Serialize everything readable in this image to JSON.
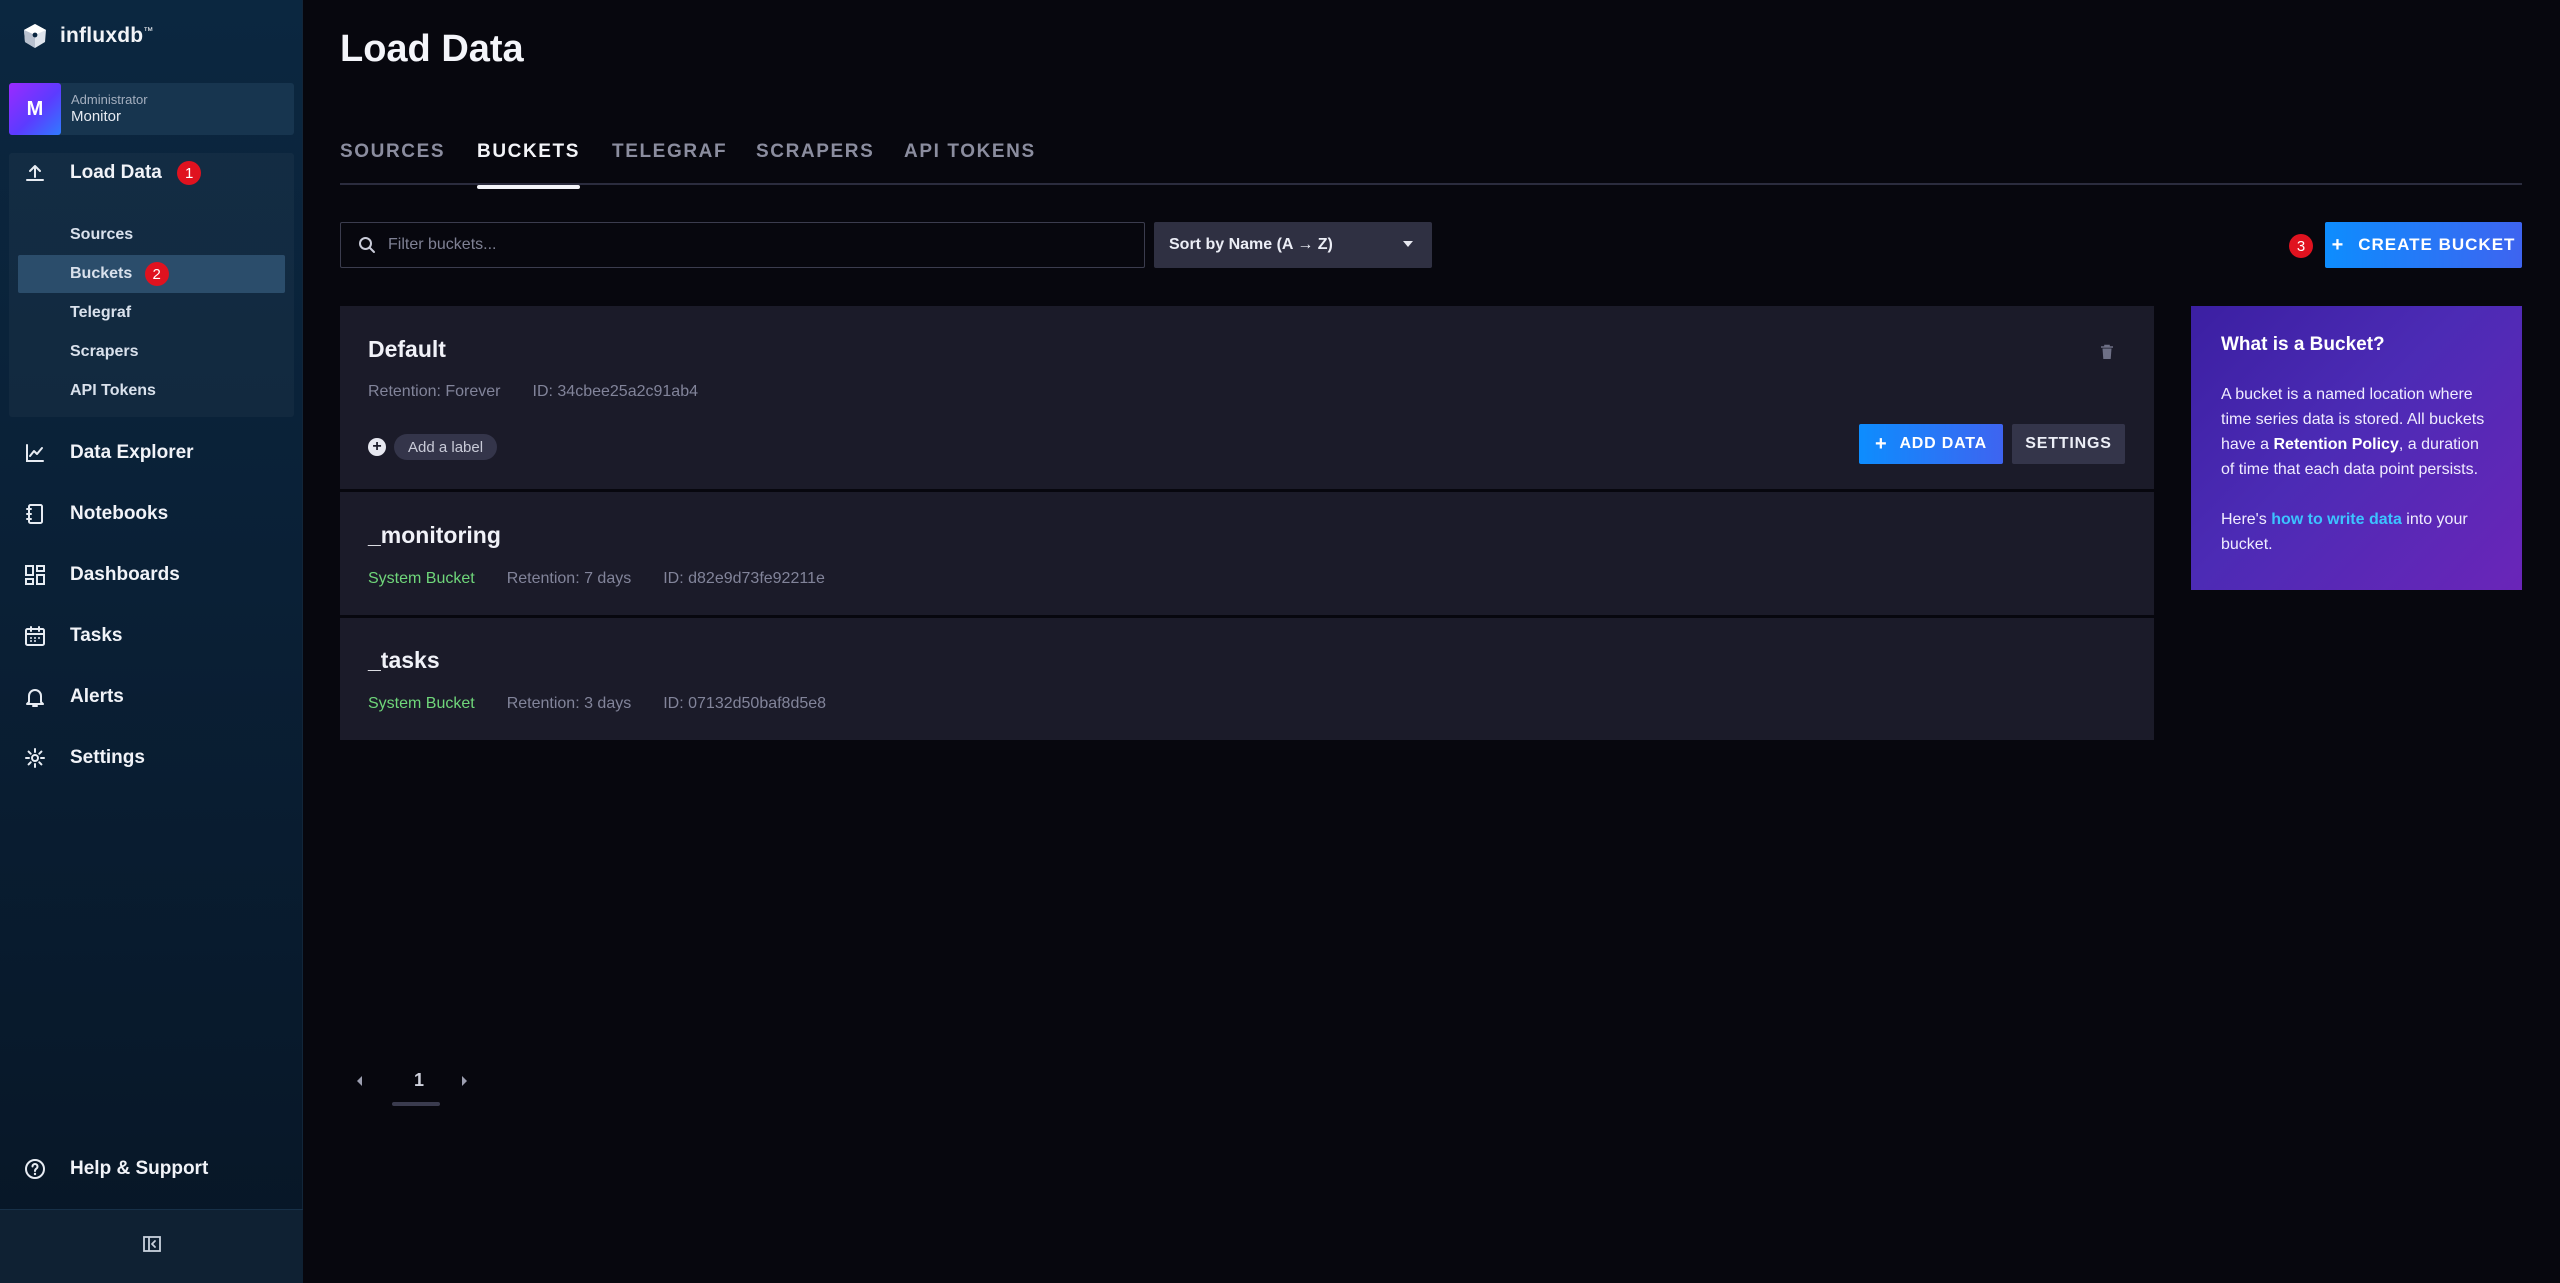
{
  "brand": {
    "name": "influxdb",
    "trademark": "™"
  },
  "org": {
    "avatar_letter": "M",
    "role": "Administrator",
    "name": "Monitor"
  },
  "sidebar": {
    "load_data": {
      "label": "Load Data",
      "badge": "1"
    },
    "sub_items": [
      {
        "label": "Sources"
      },
      {
        "label": "Buckets",
        "badge": "2"
      },
      {
        "label": "Telegraf"
      },
      {
        "label": "Scrapers"
      },
      {
        "label": "API Tokens"
      }
    ],
    "nav": [
      {
        "label": "Data Explorer",
        "icon": "graph-icon"
      },
      {
        "label": "Notebooks",
        "icon": "notebook-icon"
      },
      {
        "label": "Dashboards",
        "icon": "dashboards-icon"
      },
      {
        "label": "Tasks",
        "icon": "calendar-icon"
      },
      {
        "label": "Alerts",
        "icon": "bell-icon"
      },
      {
        "label": "Settings",
        "icon": "gear-icon"
      }
    ],
    "help": {
      "label": "Help & Support",
      "icon": "help-icon"
    }
  },
  "page": {
    "title": "Load Data"
  },
  "tabs": [
    {
      "label": "SOURCES",
      "active": false
    },
    {
      "label": "BUCKETS",
      "active": true
    },
    {
      "label": "TELEGRAF",
      "active": false
    },
    {
      "label": "SCRAPERS",
      "active": false
    },
    {
      "label": "API TOKENS",
      "active": false
    }
  ],
  "toolbar": {
    "filter_placeholder": "Filter buckets...",
    "sort_label": "Sort by Name (A → Z)",
    "step_badge": "3",
    "create_label": "CREATE BUCKET",
    "create_plus": "+"
  },
  "buckets": [
    {
      "name": "Default",
      "retention": "Retention: Forever",
      "id": "ID: 34cbee25a2c91ab4",
      "add_label": "Add a label",
      "add_data": "ADD DATA",
      "settings": "SETTINGS"
    },
    {
      "name": "_monitoring",
      "system": "System Bucket",
      "retention": "Retention: 7 days",
      "id": "ID: d82e9d73fe92211e"
    },
    {
      "name": "_tasks",
      "system": "System Bucket",
      "retention": "Retention: 3 days",
      "id": "ID: 07132d50baf8d5e8"
    }
  ],
  "info": {
    "title": "What is a Bucket?",
    "p1_a": "A bucket is a named location where time series data is stored. All buckets have a ",
    "p1_bold": "Retention Policy",
    "p1_b": ", a duration of time that each data point persists.",
    "p2_a": "Here's ",
    "p2_link": "how to write data",
    "p2_b": " into your bucket."
  },
  "pagination": {
    "current": "1"
  },
  "colors": {
    "accent_blue": "#0d8dfe",
    "badge_red": "#e0121f",
    "system_green": "#6fd67a",
    "panel_purple": "#4c2bb5"
  }
}
